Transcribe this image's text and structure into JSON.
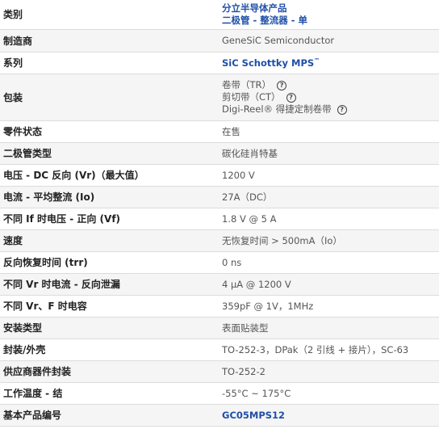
{
  "rows": [
    {
      "label": "类别",
      "lines": [
        "分立半导体产品",
        "二极管 - 整流器 - 单"
      ],
      "link": true
    },
    {
      "label": "制造商",
      "value": "GeneSiC Semiconductor"
    },
    {
      "label": "系列",
      "value": "SiC Schottky MPS",
      "sup": "™",
      "link": true
    },
    {
      "label": "包装",
      "packaging": [
        {
          "text": "卷带（TR）"
        },
        {
          "text": "剪切带（CT）"
        },
        {
          "text": "Digi-Reel® 得捷定制卷带"
        }
      ]
    },
    {
      "label": "零件状态",
      "value": "在售"
    },
    {
      "label": "二极管类型",
      "value": "碳化硅肖特基"
    },
    {
      "label": "电压 - DC 反向 (Vr)（最大值）",
      "value": "1200 V"
    },
    {
      "label": "电流 - 平均整流 (Io)",
      "value": "27A（DC）"
    },
    {
      "label": "不同 If 时电压 - 正向 (Vf)",
      "value": "1.8 V @ 5 A"
    },
    {
      "label": "速度",
      "value": "无恢复时间 > 500mA（Io）"
    },
    {
      "label": "反向恢复时间 (trr)",
      "value": "0 ns"
    },
    {
      "label": "不同 Vr 时电流 - 反向泄漏",
      "value": "4 µA @ 1200 V"
    },
    {
      "label": "不同 Vr、F 时电容",
      "value": "359pF @ 1V，1MHz"
    },
    {
      "label": "安装类型",
      "value": "表面贴装型"
    },
    {
      "label": "封装/外壳",
      "value": "TO-252-3，DPak（2 引线 + 接片），SC-63"
    },
    {
      "label": "供应商器件封装",
      "value": "TO-252-2"
    },
    {
      "label": "工作温度 - 结",
      "value": "-55°C ~ 175°C"
    },
    {
      "label": "基本产品编号",
      "value": "GC05MPS12",
      "link": true
    }
  ],
  "icons": {
    "help": "question-circle-icon",
    "help_glyph": "?"
  }
}
